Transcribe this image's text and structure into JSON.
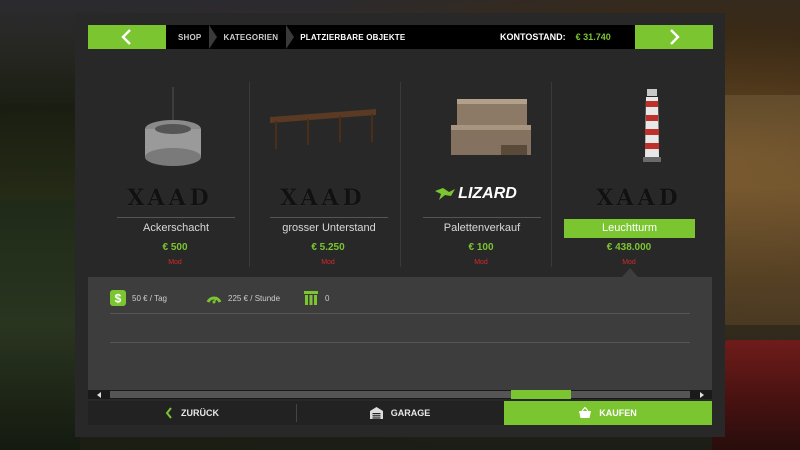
{
  "header": {
    "back_icon": "chevron-left-icon",
    "next_icon": "chevron-right-icon",
    "breadcrumbs": [
      "SHOP",
      "KATEGORIEN",
      "PLATZIERBARE OBJEKTE"
    ],
    "balance_label": "KONTOSTAND:",
    "balance_value": "€ 31.740"
  },
  "items": [
    {
      "name": "Ackerschacht",
      "price": "€ 500",
      "tag": "Mod",
      "brand": "XAAD",
      "image_icon": "well-shaft-icon"
    },
    {
      "name": "grosser Unterstand",
      "price": "€ 5.250",
      "tag": "Mod",
      "brand": "XAAD",
      "image_icon": "shelter-icon"
    },
    {
      "name": "Palettenverkauf",
      "price": "€ 100",
      "tag": "Mod",
      "brand": "LIZARD",
      "image_icon": "pallet-stack-icon"
    },
    {
      "name": "Leuchtturm",
      "price": "€ 438.000",
      "tag": "Mod",
      "brand": "XAAD",
      "image_icon": "lighthouse-icon",
      "selected": true
    }
  ],
  "details": {
    "daily_cost": "50 € / Tag",
    "hourly_cost": "225 € / Stunde",
    "storage": "0"
  },
  "scrollbar": {
    "position_fraction": 0.72
  },
  "footer": {
    "back_label": "ZURÜCK",
    "garage_label": "GARAGE",
    "buy_label": "KAUFEN"
  },
  "colors": {
    "accent": "#7bc531",
    "mod_tag": "#d12a2a",
    "panel": "#282828"
  }
}
